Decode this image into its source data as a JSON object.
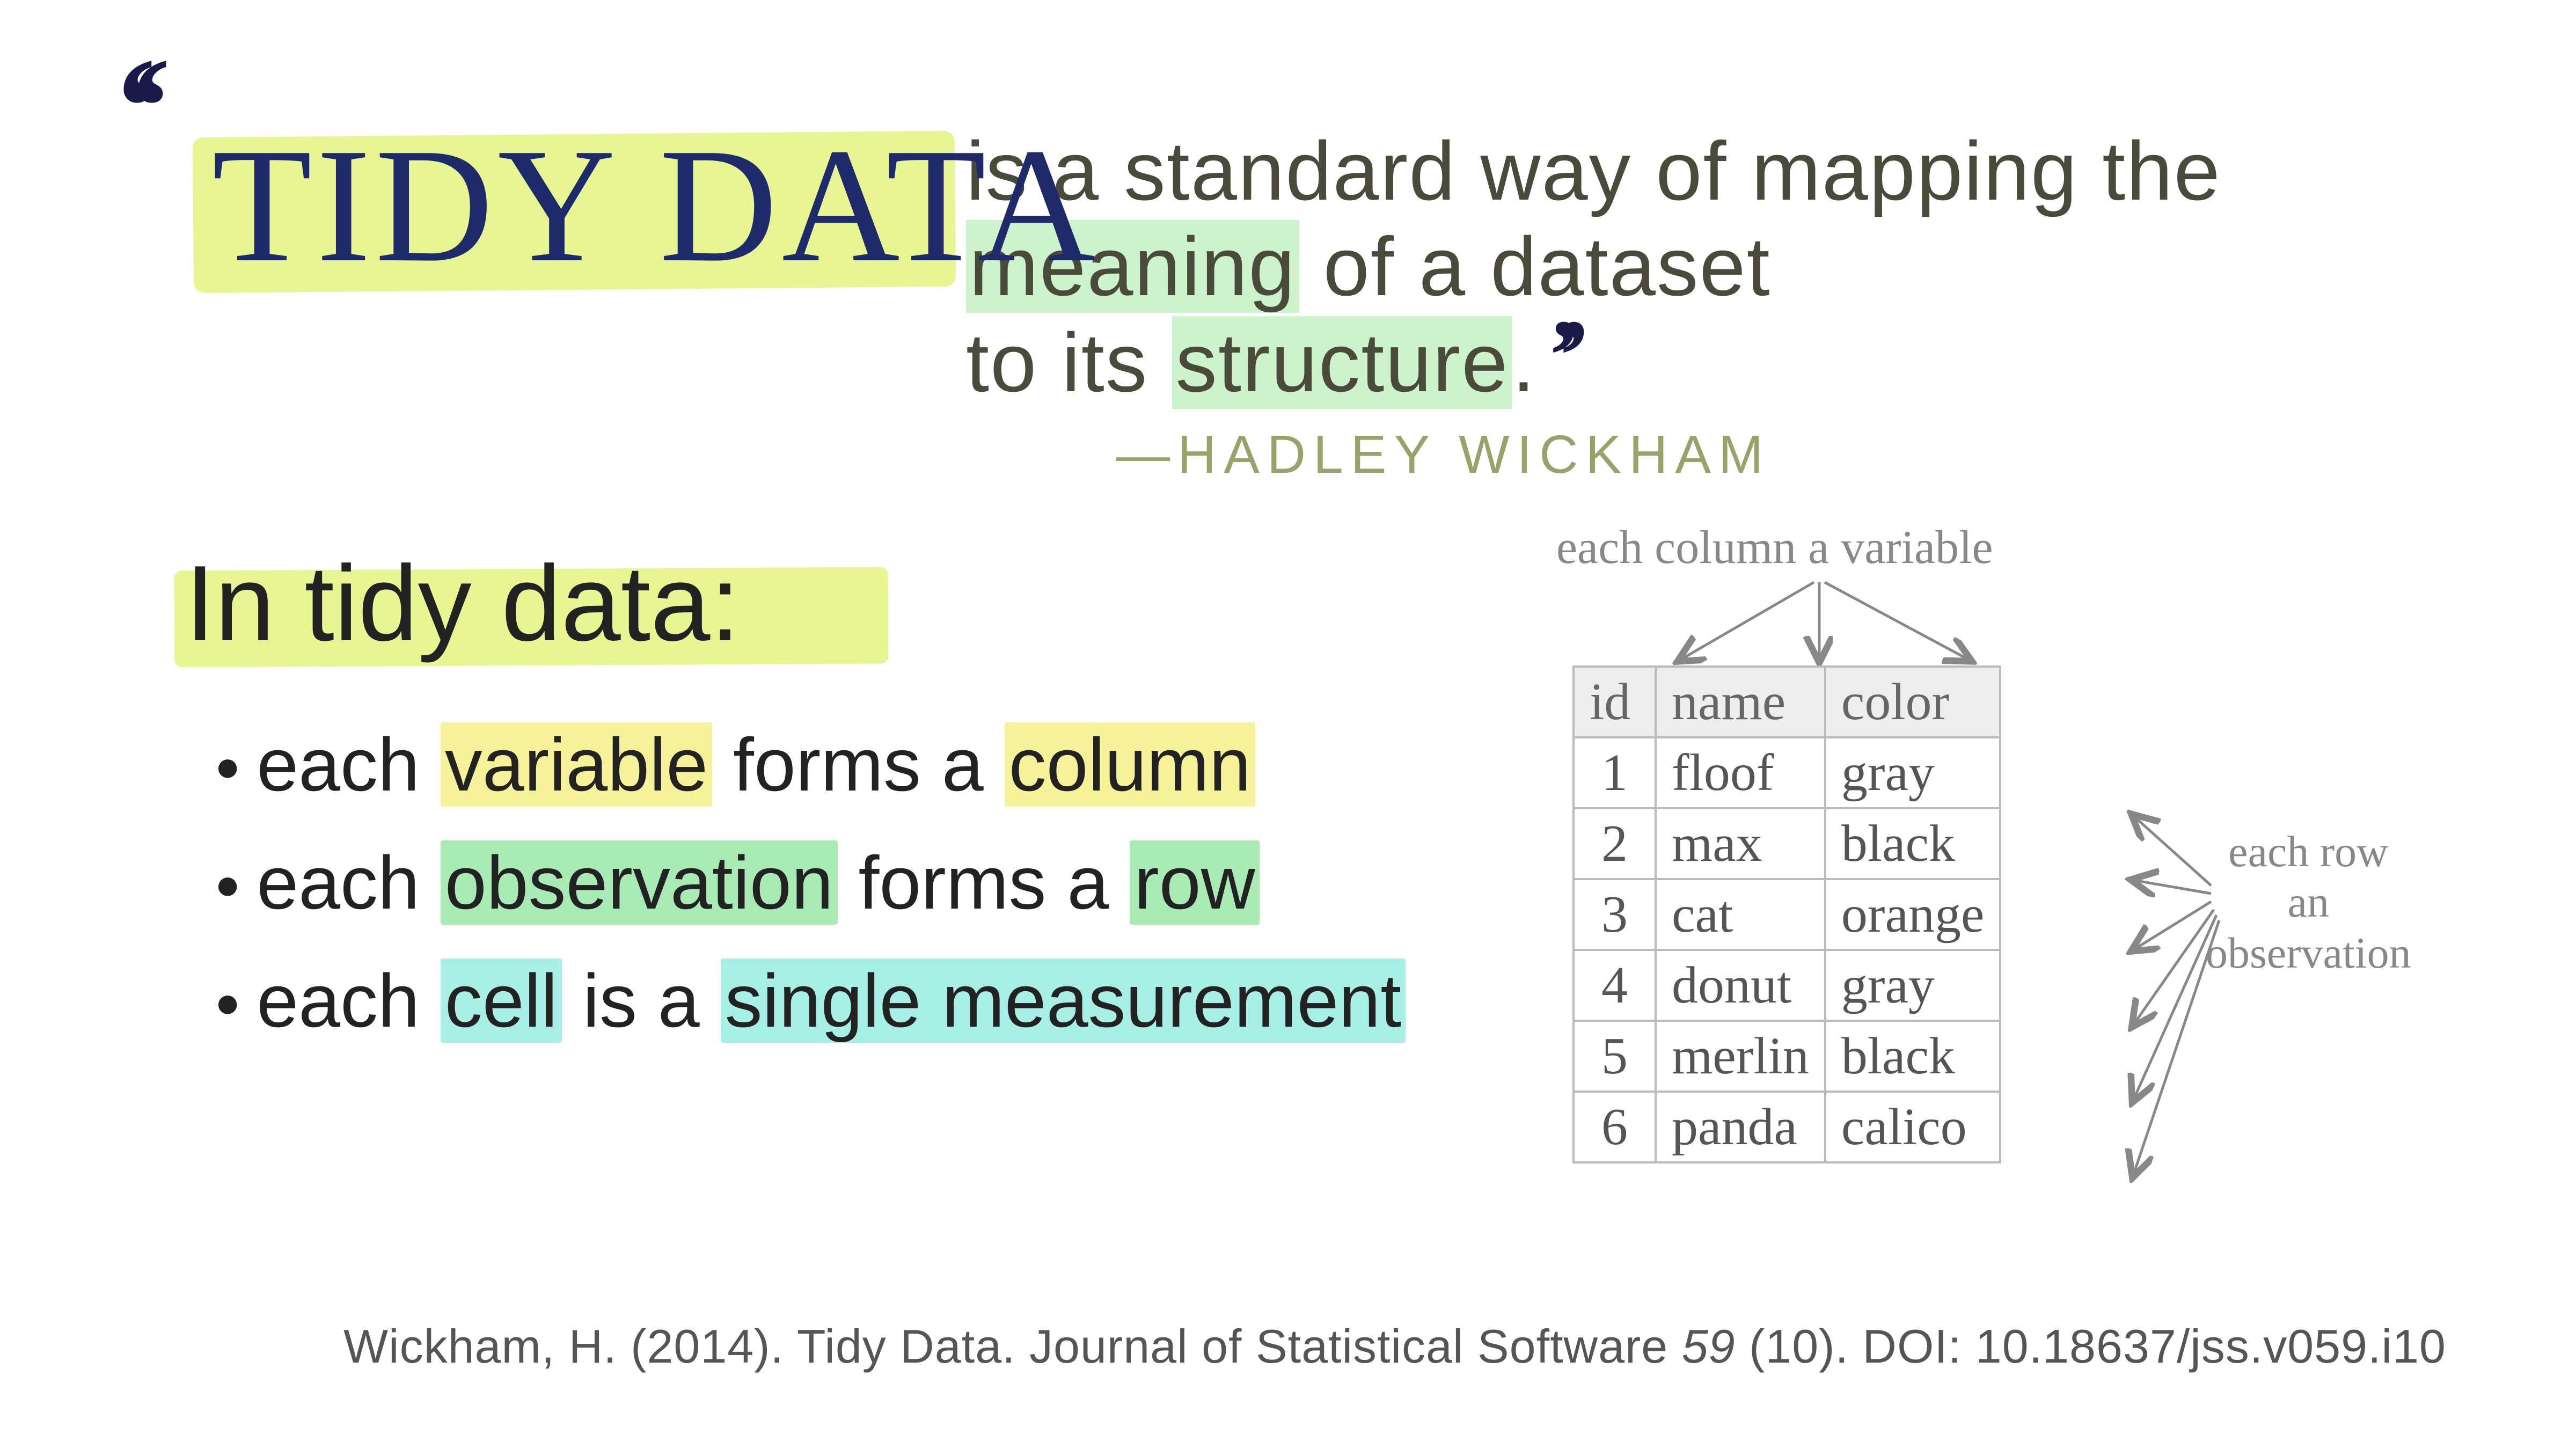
{
  "header": {
    "tidy_title": "TIDY DATA",
    "quote_line1": "is a standard way of mapping the",
    "quote_line2_pre": "",
    "quote_line2_hl": "meaning",
    "quote_line2_post": " of a dataset",
    "quote_line3_pre": "to its ",
    "quote_line3_hl": "structure",
    "quote_line3_post": ".",
    "attribution": "—HADLEY WICKHAM"
  },
  "subheading": "In tidy data:",
  "bullets": [
    {
      "pre": "each ",
      "hl1": "variable",
      "mid": " forms a ",
      "hl2": "column",
      "cls": "yellow"
    },
    {
      "pre": "each ",
      "hl1": "observation",
      "mid": " forms a ",
      "hl2": "row",
      "cls": "green"
    },
    {
      "pre": "each ",
      "hl1": "cell",
      "mid": " is a ",
      "hl2": "single measurement",
      "cls": "teal"
    }
  ],
  "annotations": {
    "top": "each column a variable",
    "right_l1": "each row",
    "right_l2": "an",
    "right_l3": "observation"
  },
  "table": {
    "headers": [
      "id",
      "name",
      "color"
    ],
    "rows": [
      [
        "1",
        "floof",
        "gray"
      ],
      [
        "2",
        "max",
        "black"
      ],
      [
        "3",
        "cat",
        "orange"
      ],
      [
        "4",
        "donut",
        "gray"
      ],
      [
        "5",
        "merlin",
        "black"
      ],
      [
        "6",
        "panda",
        "calico"
      ]
    ]
  },
  "citation": {
    "pre": "Wickham, H. (2014). Tidy Data. Journal of Statistical Software ",
    "vol": "59",
    "post": " (10). DOI: 10.18637/jss.v059.i10"
  },
  "colors": {
    "highlight_lime": "#e7f593",
    "highlight_yellow": "#f5f29a",
    "highlight_green": "#a9ebb5",
    "highlight_teal": "#a8efe6",
    "title_navy": "#1f2a6b",
    "attribution_olive": "#9aa26a"
  }
}
